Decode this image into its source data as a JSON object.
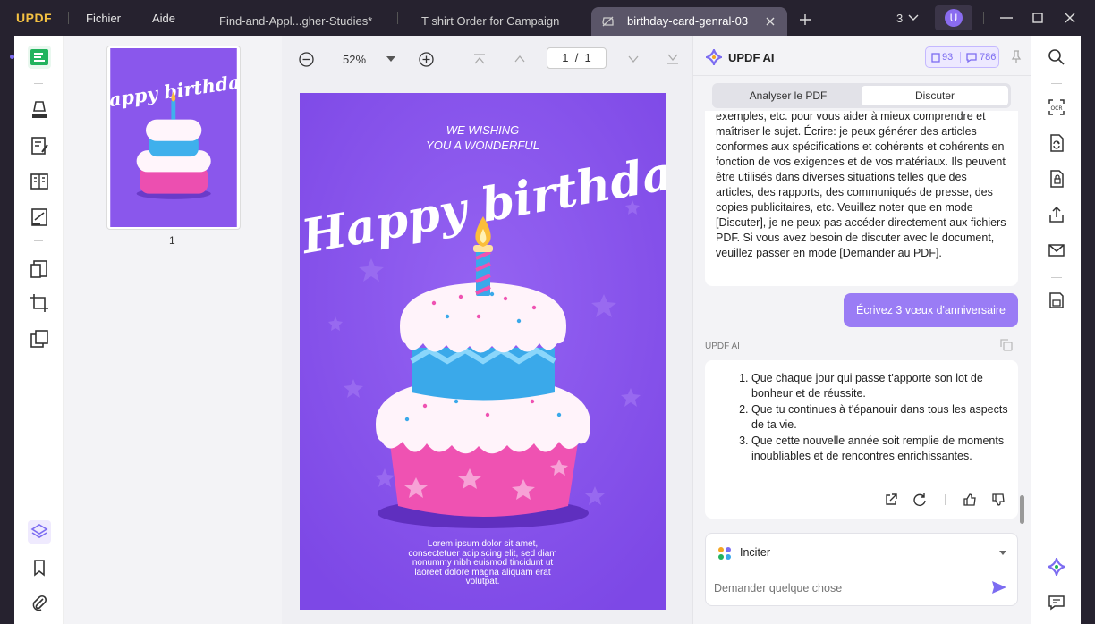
{
  "app": {
    "logo": "UPDF"
  },
  "menu": {
    "file": "Fichier",
    "help": "Aide"
  },
  "tabs": [
    {
      "label": "Find-and-Appl...gher-Studies*"
    },
    {
      "label": "T shirt Order for Campaign"
    },
    {
      "label": "birthday-card-genral-03"
    }
  ],
  "window": {
    "count": "3",
    "avatar": "U"
  },
  "viewer": {
    "zoom": "52%",
    "page_current": "1",
    "page_sep": "/",
    "page_total": "1"
  },
  "thumbnail": {
    "label": "1"
  },
  "card": {
    "line1": "WE WISHING",
    "line2": "YOU A WONDERFUL",
    "headline": "Happy birthday",
    "body": [
      "Lorem ipsum dolor sit amet,",
      "consectetuer adipiscing elit, sed diam",
      "nonummy nibh euismod tincidunt ut",
      "laoreet dolore magna aliquam erat",
      "volutpat."
    ]
  },
  "ai": {
    "title": "UPDF AI",
    "credit_a": "93",
    "credit_b": "786",
    "tab_analyze": "Analyser le PDF",
    "tab_chat": "Discuter",
    "prev_response": "exemples, etc. pour vous aider à mieux comprendre et maîtriser le sujet. Écrire: je peux générer des articles conformes aux spécifications et cohérents et cohérents en fonction de vos exigences et de vos matériaux. Ils peuvent être utilisés dans diverses situations telles que des articles, des rapports, des communiqués de presse, des copies publicitaires, etc. Veuillez noter que en mode [Discuter], je ne peux pas accéder directement aux fichiers PDF. Si vous avez besoin de discuter avec le document, veuillez passer en mode [Demander au PDF].",
    "user_message": "Écrivez 3 vœux d'anniversaire",
    "responder_label": "UPDF AI",
    "wishes": [
      "Que chaque jour qui passe t'apporte son lot de bonheur et de réussite.",
      "Que tu continues à t'épanouir dans tous les aspects de ta vie.",
      "Que cette nouvelle année soit remplie de moments inoubliables et de rencontres enrichissantes."
    ],
    "prompt_select": "Inciter",
    "input_placeholder": "Demander quelque chose"
  },
  "colors": {
    "accent": "#7c6cf1",
    "card_bg": "#8a57ec",
    "user_bubble": "#9a7cf5",
    "topbar": "#26222f"
  }
}
